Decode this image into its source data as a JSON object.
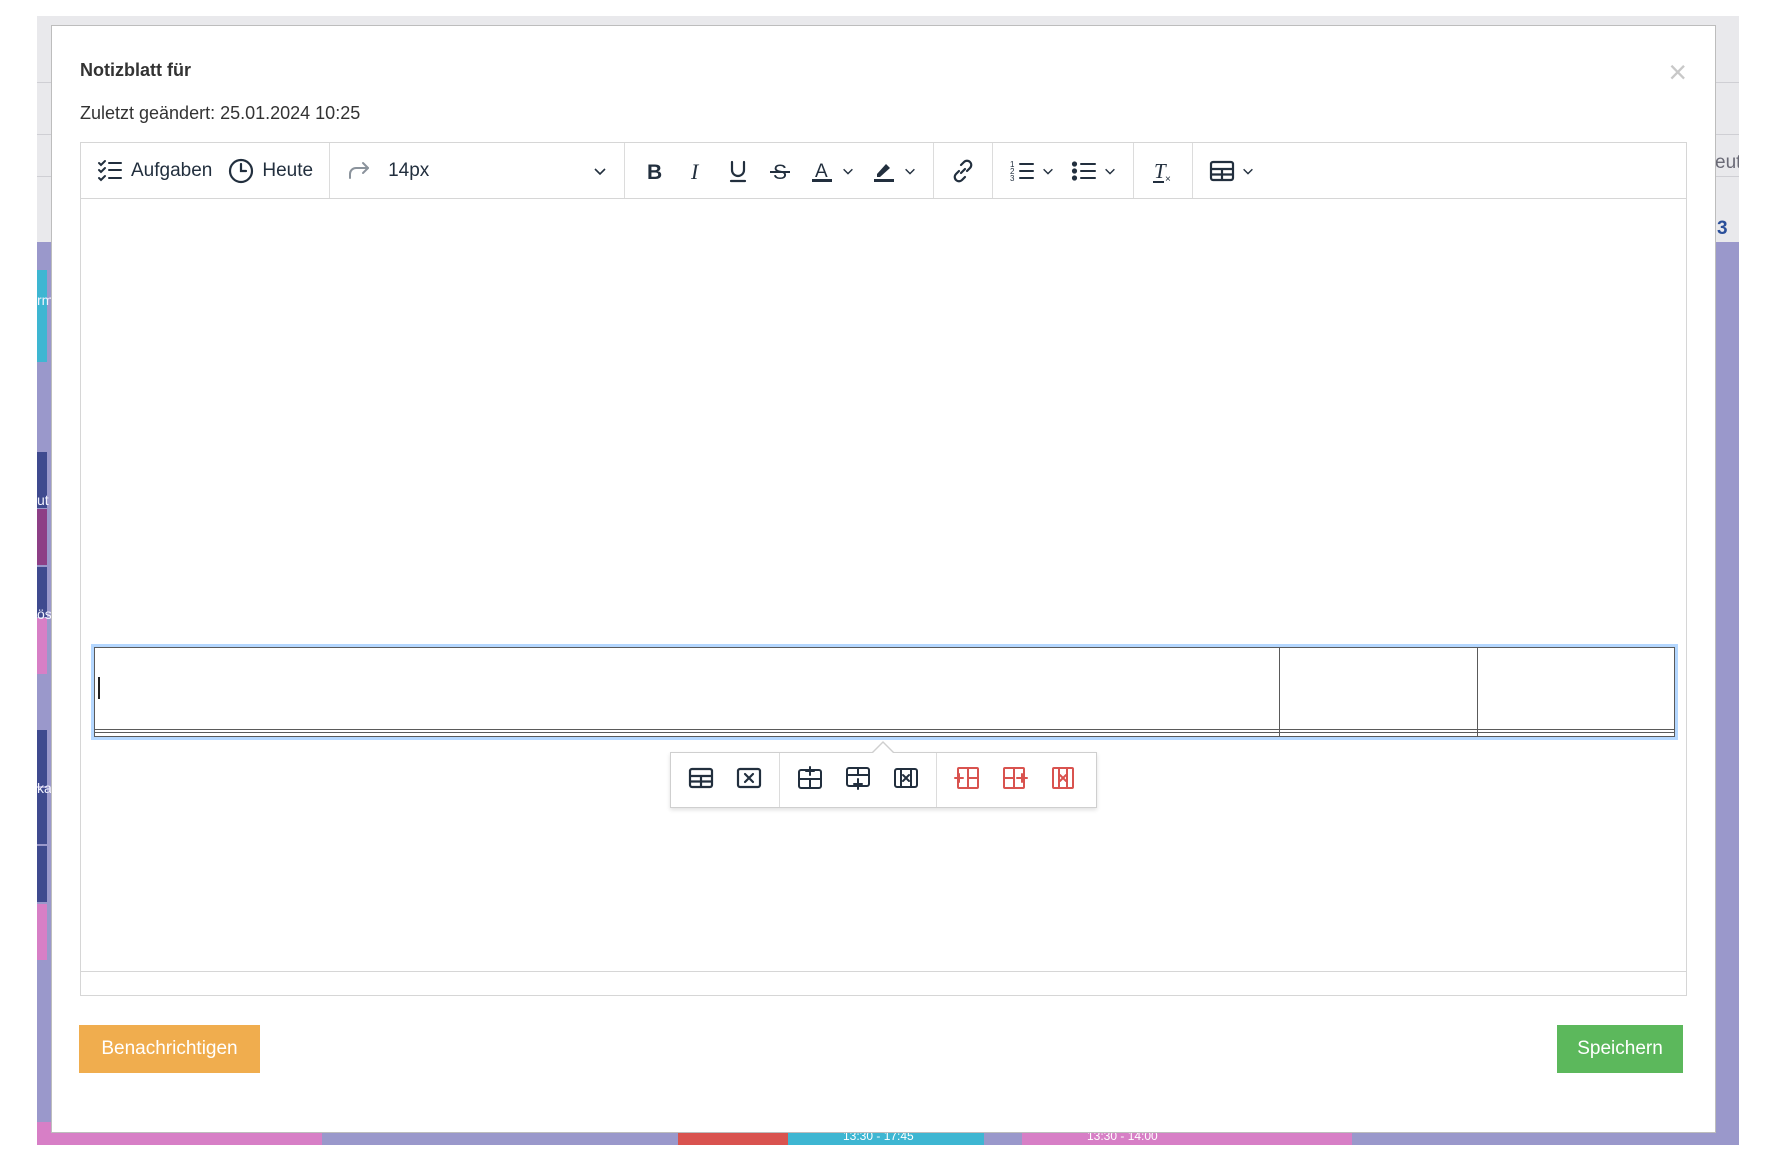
{
  "modal": {
    "title": "Notizblatt für",
    "subtitle": "Zuletzt geändert: 25.01.2024 10:25",
    "close_glyph": "×"
  },
  "toolbar": {
    "tasks_label": "Aufgaben",
    "tasks_icon": "checklist-icon",
    "today_label": "Heute",
    "today_icon": "clock-icon",
    "redo_icon": "redo-icon",
    "font_size_value": "14px",
    "format_icons": [
      "bold-icon",
      "italic-icon",
      "underline-icon",
      "strikethrough-icon",
      "text-color-icon",
      "highlight-color-icon"
    ],
    "link_icon": "link-icon",
    "list_icons": [
      "numbered-list-icon",
      "bulleted-list-icon"
    ],
    "clear_format_icon": "clear-formatting-icon",
    "table_icon": "table-icon"
  },
  "table": {
    "rows": [
      [
        "",
        "",
        ""
      ],
      [
        "",
        "",
        ""
      ],
      [
        "",
        "",
        ""
      ]
    ]
  },
  "table_toolbar": {
    "groups": [
      [
        "table-properties-icon",
        "delete-table-icon"
      ],
      [
        "insert-row-before-icon",
        "insert-row-after-icon",
        "delete-row-icon"
      ],
      [
        "insert-column-before-icon",
        "insert-column-after-icon",
        "delete-column-icon"
      ]
    ]
  },
  "footer": {
    "notify_label": "Benachrichtigen",
    "save_label": "Speichern"
  },
  "colors": {
    "notify": "#f0ad4e",
    "save": "#5cb85c",
    "icon": "#222f3e",
    "column_icons": "#d9534f",
    "table_focus": "#b4d7ff"
  },
  "background": {
    "visible_fragments": [
      "rm",
      "ut",
      "ös",
      "ka",
      "eute",
      "3",
      "13:30 - 17:45",
      "13:30 - 14:00"
    ]
  }
}
